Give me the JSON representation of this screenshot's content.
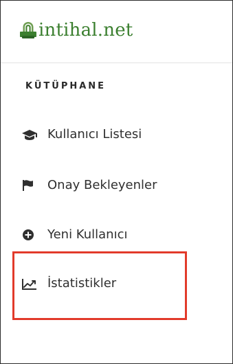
{
  "brand": {
    "name": "intihal.net",
    "logo_icon": "fingerprint-icon",
    "brand_color": "#3b7f2f"
  },
  "sidebar": {
    "section_title": "KÜTÜPHANE",
    "items": [
      {
        "label": "Kullanıcı Listesi",
        "icon": "graduation-cap-icon"
      },
      {
        "label": "Onay Bekleyenler",
        "icon": "flag-icon"
      },
      {
        "label": "Yeni Kullanıcı",
        "icon": "plus-circle-icon"
      },
      {
        "label": "İstatistikler",
        "icon": "line-chart-icon"
      }
    ]
  },
  "colors": {
    "text": "#2f2f2f",
    "highlight_border": "#e23a2a",
    "frame_border": "#2b2b2b"
  }
}
